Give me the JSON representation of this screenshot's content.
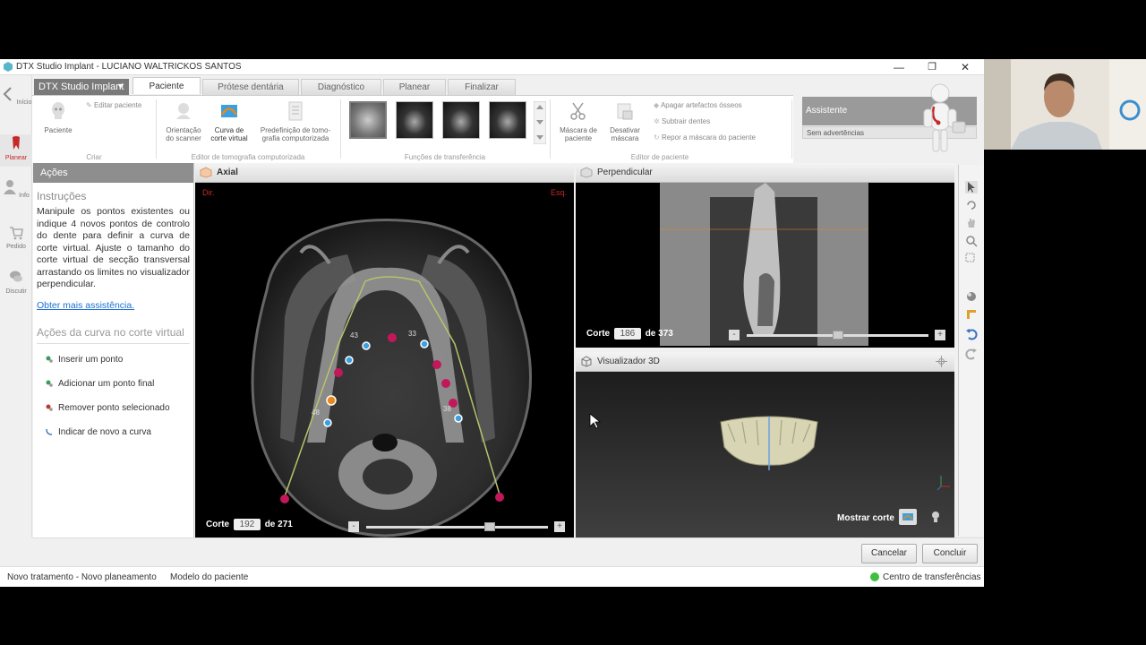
{
  "window": {
    "title": "DTX Studio Implant - LUCIANO WALTRICKOS SANTOS",
    "minimize_glyph": "—",
    "restore_glyph": "❐",
    "close_glyph": "✕"
  },
  "nav": {
    "items": [
      {
        "label": "Início",
        "icon": "back-arrow-icon"
      },
      {
        "label": "Planear",
        "icon": "tooth-icon"
      },
      {
        "label": "Info",
        "icon": "person-icon"
      },
      {
        "label": "Pedido",
        "icon": "cart-icon"
      },
      {
        "label": "Discutir",
        "icon": "chat-icon"
      }
    ]
  },
  "ribbon": {
    "app_dropdown": "DTX Studio Implant",
    "dropdown_arrow": "▼",
    "tabs": [
      "Paciente",
      "Prótese dentária",
      "Diagnóstico",
      "Planear",
      "Finalizar"
    ],
    "active_tab": "Paciente",
    "groups": {
      "criar": {
        "label": "Criar",
        "paciente": "Paciente",
        "editar": "Editar paciente"
      },
      "tomografia": {
        "label": "Editor de tomografia computorizada",
        "orientacao": [
          "Orientação",
          "do scanner"
        ],
        "curva": [
          "Curva de",
          "corte virtual"
        ],
        "predefinicao": [
          "Predefinição de tomo-",
          "grafia computorizada"
        ]
      },
      "transferencia": {
        "label": "Funções de transferência"
      },
      "mascara": {
        "label": "Editor de paciente",
        "mascara": [
          "Máscara de",
          "paciente"
        ],
        "desativar": [
          "Desativar",
          "máscara"
        ],
        "apagar": "Apagar artefactos ósseos",
        "subtrair": "Subtrair dentes",
        "repor": "Repor a máscara do paciente"
      }
    }
  },
  "assistant": {
    "title": "Assistente",
    "status": "Sem advertências"
  },
  "actions": {
    "header": "Ações",
    "instructions_title": "Instruções",
    "instructions": "Manipule os pontos existentes ou indique 4 novos pontos de controlo do dente para definir a curva de corte virtual. Ajuste o tamanho do corte virtual de secção transversal arrastando os limites no visualizador perpendicular.",
    "help_link": "Obter mais assistência.",
    "curve_actions_title": "Ações da curva no corte virtual",
    "items": [
      {
        "label": "Inserir um ponto",
        "icon": "insert-point-icon",
        "color": "#3c9a5f"
      },
      {
        "label": "Adicionar um ponto final",
        "icon": "add-endpoint-icon",
        "color": "#3c9a5f"
      },
      {
        "label": "Remover ponto selecionado",
        "icon": "remove-point-icon",
        "color": "#c0392b"
      },
      {
        "label": "Indicar de novo a curva",
        "icon": "redraw-curve-icon",
        "color": "#4a7fb5"
      }
    ]
  },
  "axial": {
    "title": "Axial",
    "left_marker": "Dir.",
    "right_marker": "Esq.",
    "slice_label": "Corte",
    "slice_value": "192",
    "slice_total": "de 271",
    "tooth_labels": [
      "43",
      "33",
      "48",
      "38"
    ],
    "minus": "-",
    "plus": "+",
    "slider_fraction": 0.69
  },
  "perpendicular": {
    "title": "Perpendicular",
    "slice_label": "Corte",
    "slice_value": "186",
    "slice_total": "de 373",
    "minus": "-",
    "plus": "+",
    "slider_fraction": 0.5
  },
  "viewer3d": {
    "title": "Visualizador 3D",
    "show_slice": "Mostrar corte"
  },
  "footer": {
    "cancel": "Cancelar",
    "conclude": "Concluir"
  },
  "statusbar": {
    "treatment": "Novo tratamento - Novo planeamento",
    "model": "Modelo do paciente",
    "transfer_center": "Centro de transferências"
  },
  "colors": {
    "accent_pink": "#c2185b",
    "accent_blue": "#3aa0e0",
    "accent_orange": "#e88a1a",
    "curve_green": "#b8c46a"
  }
}
